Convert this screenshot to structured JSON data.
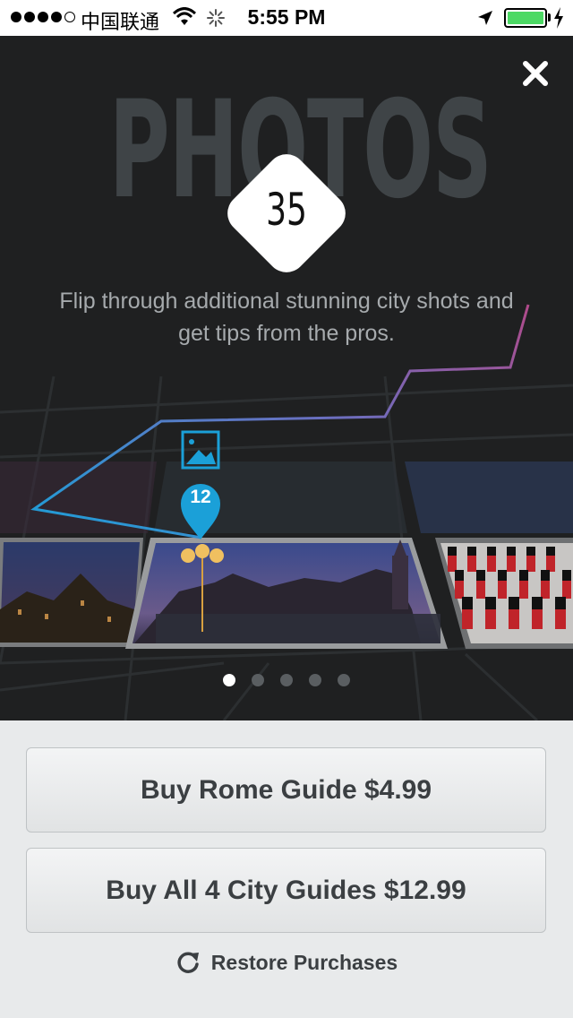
{
  "status_bar": {
    "carrier": "中国联通",
    "time": "5:55 PM",
    "signal_dots_filled": 4,
    "signal_dots_total": 5,
    "battery_level": 1.0
  },
  "hero": {
    "title": "PHOTOS",
    "count": "35",
    "tagline": "Flip through additional stunning city shots and get tips from the pros.",
    "pin_number": "12",
    "page_count": 5,
    "active_page": 1
  },
  "purchase": {
    "buy_city_label": "Buy Rome Guide $4.99",
    "buy_all_label": "Buy All 4 City Guides $12.99",
    "restore_label": "Restore Purchases"
  },
  "colors": {
    "accent_blue": "#1ba0d8",
    "route_purple": "#9b4fa8",
    "battery_green": "#4cd964"
  }
}
